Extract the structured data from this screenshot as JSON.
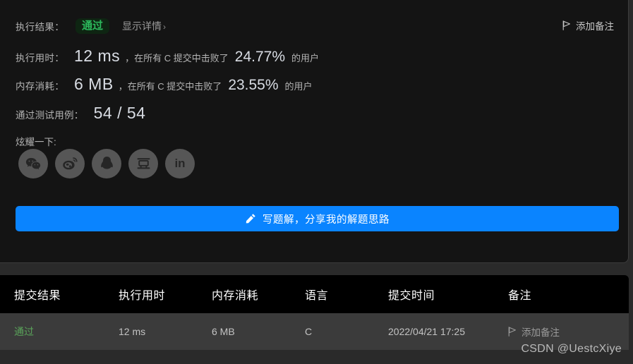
{
  "result_panel": {
    "verdict_label": "执行结果：",
    "verdict_value": "通过",
    "show_detail": "显示详情",
    "show_detail_chevron": "›",
    "add_note_top": "添加备注",
    "runtime": {
      "label": "执行用时：",
      "value": "12 ms",
      "middle": "，在所有 C 提交中击败了",
      "percent": "24.77%",
      "tail": "的用户"
    },
    "memory": {
      "label": "内存消耗：",
      "value": "6 MB",
      "middle": "，在所有 C 提交中击败了",
      "percent": "23.55%",
      "tail": "的用户"
    },
    "cases": {
      "label": "通过测试用例：",
      "value": "54 / 54"
    },
    "share_label": "炫耀一下:",
    "share_icons": [
      {
        "name": "wechat-icon",
        "title": "微信"
      },
      {
        "name": "weibo-icon",
        "title": "微博"
      },
      {
        "name": "qq-icon",
        "title": "QQ"
      },
      {
        "name": "douban-icon",
        "title": "豆瓣"
      },
      {
        "name": "linkedin-icon",
        "title": "LinkedIn",
        "glyph": "in"
      }
    ],
    "write_solution_button": "写题解，分享我的解题思路",
    "write_solution_icon": "pencil-icon",
    "accent_color": "#0a84ff",
    "pass_color": "#2cbb5d"
  },
  "submissions": {
    "headers": {
      "result": "提交结果",
      "runtime": "执行用时",
      "memory": "内存消耗",
      "language": "语言",
      "time": "提交时间",
      "note": "备注"
    },
    "rows": [
      {
        "result": "通过",
        "runtime": "12 ms",
        "memory": "6 MB",
        "language": "C",
        "time": "2022/04/21 17:25",
        "note": "添加备注"
      }
    ]
  },
  "watermark": "CSDN @UestcXiye"
}
